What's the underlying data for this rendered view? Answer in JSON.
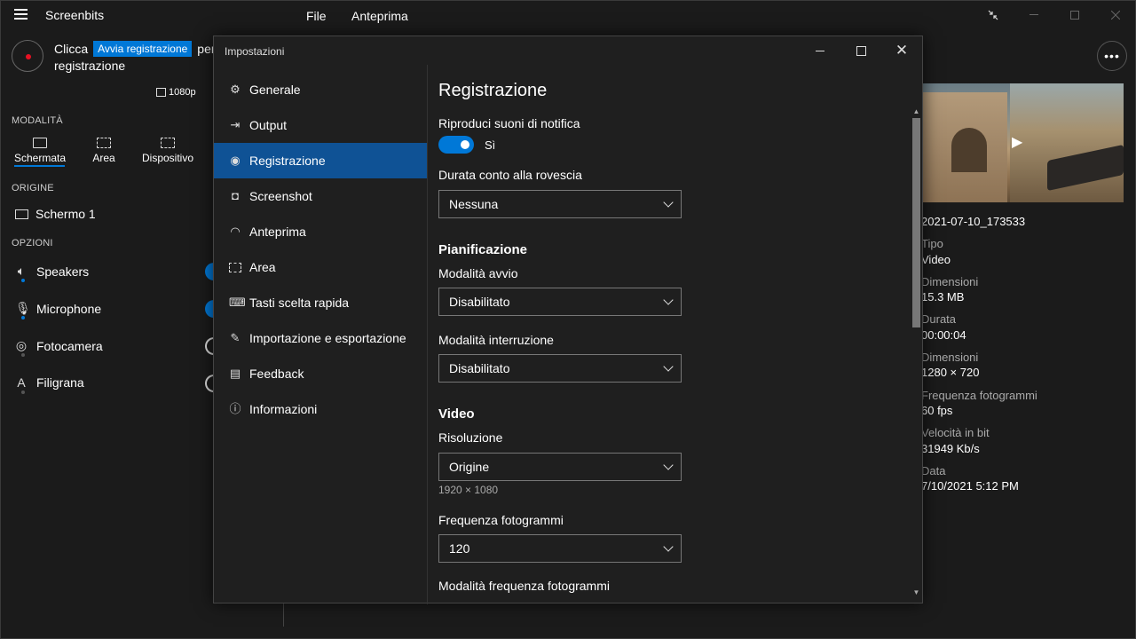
{
  "app": {
    "title": "Screenbits",
    "menu": [
      "File",
      "Anteprima"
    ]
  },
  "left": {
    "hint_before": "Clicca",
    "hint_chip": "Avvia registrazione",
    "hint_after": "per",
    "hint_line2": "registrazione",
    "resolution_chip": "1080p",
    "mode_label": "MODALITÀ",
    "modes": [
      "Schermata",
      "Area",
      "Dispositivo"
    ],
    "origin_label": "ORIGINE",
    "origin_value": "Schermo 1",
    "options_label": "OPZIONI",
    "options": [
      "Speakers",
      "Microphone",
      "Fotocamera",
      "Filigrana"
    ]
  },
  "info": {
    "more": "•••",
    "filename": "2021-07-10_173533",
    "rows": [
      {
        "label": "Tipo",
        "value": "Video"
      },
      {
        "label": "Dimensioni",
        "value": "15.3 MB"
      },
      {
        "label": "Durata",
        "value": "00:00:04"
      },
      {
        "label": "Dimensioni",
        "value": "1280 × 720"
      },
      {
        "label": "Frequenza fotogrammi",
        "value": "60 fps"
      },
      {
        "label": "Velocità in bit",
        "value": "31949 Kb/s"
      },
      {
        "label": "Data",
        "value": "7/10/2021 5:12 PM"
      }
    ]
  },
  "dialog": {
    "title": "Impostazioni",
    "nav": [
      {
        "label": "Generale",
        "icon": "settings-gear-icon"
      },
      {
        "label": "Output",
        "icon": "output-export-icon"
      },
      {
        "label": "Registrazione",
        "icon": "record-icon"
      },
      {
        "label": "Screenshot",
        "icon": "camera-icon"
      },
      {
        "label": "Anteprima",
        "icon": "eye-icon"
      },
      {
        "label": "Area",
        "icon": "area-select-icon"
      },
      {
        "label": "Tasti scelta rapida",
        "icon": "keyboard-icon"
      },
      {
        "label": "Importazione e esportazione",
        "icon": "edit-icon"
      },
      {
        "label": "Feedback",
        "icon": "feedback-icon"
      },
      {
        "label": "Informazioni",
        "icon": "info-icon"
      }
    ],
    "active_nav": "Registrazione",
    "content": {
      "title": "Registrazione",
      "notify_label": "Riproduci suoni di notifica",
      "notify_state": "Sì",
      "notify_on": true,
      "countdown_label": "Durata conto alla rovescia",
      "countdown_value": "Nessuna",
      "schedule_head": "Pianificazione",
      "start_label": "Modalità avvio",
      "start_value": "Disabilitato",
      "stop_label": "Modalità interruzione",
      "stop_value": "Disabilitato",
      "video_head": "Video",
      "resolution_label": "Risoluzione",
      "resolution_value": "Origine",
      "resolution_sub": "1920 × 1080",
      "fps_label": "Frequenza fotogrammi",
      "fps_value": "120",
      "fps_mode_label": "Modalità frequenza fotogrammi"
    }
  },
  "colors": {
    "accent": "#0078d7",
    "nav_active": "#0f5295",
    "record": "#e81123",
    "background": "#1b1b1b"
  }
}
